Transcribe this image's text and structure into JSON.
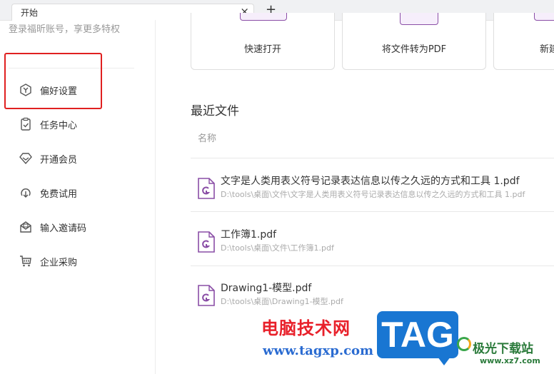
{
  "tab": {
    "label": "开始",
    "close": "×",
    "new_tab": "+"
  },
  "sidebar": {
    "login_hint": "登录福昕账号，享更多特权",
    "items": [
      {
        "label": "偏好设置",
        "icon": "preferences-icon"
      },
      {
        "label": "任务中心",
        "icon": "task-center-icon"
      },
      {
        "label": "开通会员",
        "icon": "membership-icon"
      },
      {
        "label": "免费试用",
        "icon": "free-trial-icon"
      },
      {
        "label": "输入邀请码",
        "icon": "invite-code-icon"
      },
      {
        "label": "企业采购",
        "icon": "enterprise-purchase-icon"
      }
    ]
  },
  "quick_actions": [
    {
      "label": "快速打开"
    },
    {
      "label": "将文件转为PDF"
    },
    {
      "label": "新建"
    }
  ],
  "recent": {
    "title": "最近文件",
    "column_name": "名称",
    "files": [
      {
        "name": "文字是人类用表义符号记录表达信息以传之久远的方式和工具 1.pdf",
        "path": "D:\\tools\\桌面\\文件\\文字是人类用表义符号记录表达信息以传之久远的方式和工具 1.pdf"
      },
      {
        "name": "工作簿1.pdf",
        "path": "D:\\tools\\桌面\\文件\\工作簿1.pdf"
      },
      {
        "name": "Drawing1-模型.pdf",
        "path": "D:\\tools\\桌面\\Drawing1-模型.pdf"
      }
    ]
  },
  "watermark": {
    "site_name": "电脑技术网",
    "site_url": "www.tagxp.com",
    "tag": "TAG",
    "logo_text": "极光下载站",
    "logo_url": "www.xz7.com"
  },
  "colors": {
    "accent": "#8a4ea6",
    "highlight": "#e02020"
  }
}
